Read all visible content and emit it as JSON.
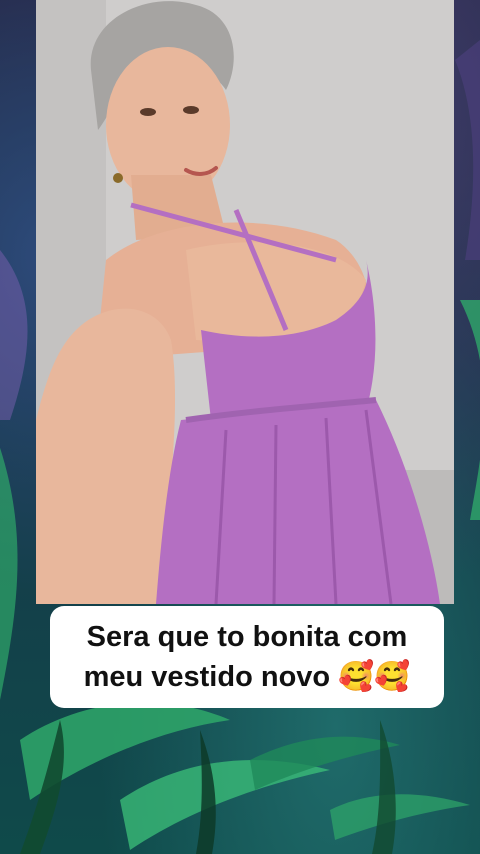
{
  "caption": {
    "text": "Sera que to bonita com\nmeu vestido novo 🥰🥰"
  },
  "photo": {
    "dress_color": "#b46fc2",
    "wall_color": "#cfcdcc",
    "background_accent": "#2fa86a"
  }
}
